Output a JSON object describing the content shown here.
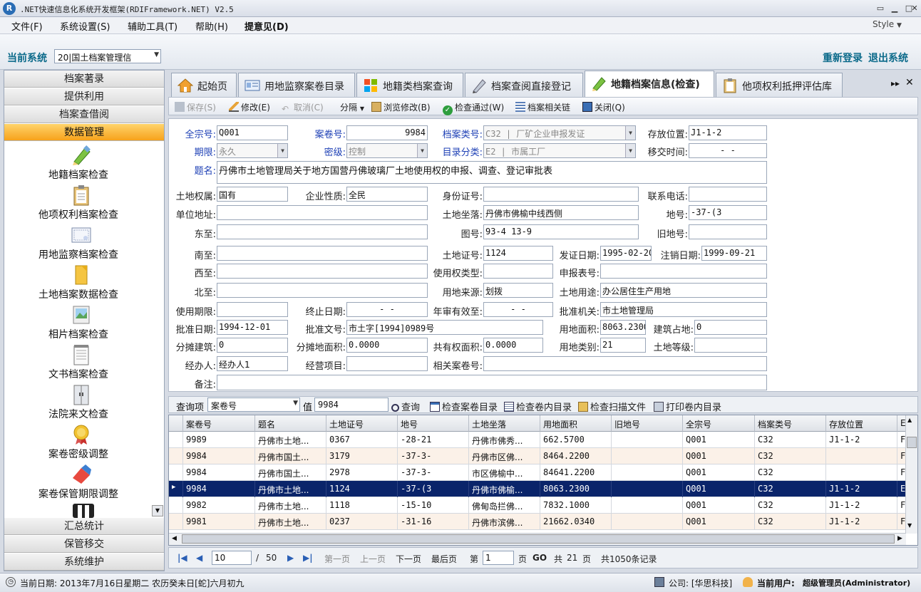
{
  "app": {
    "title": ".NET快速信息化系统开发框架(RDIFramework.NET) V2.5",
    "style_label": "Style"
  },
  "menu": [
    "文件(F)",
    "系统设置(S)",
    "辅助工具(T)",
    "帮助(H)",
    "提意见(D)"
  ],
  "sysbar": {
    "label": "当前系统",
    "system_value": "20|国土档案管理信",
    "relogin": "重新登录",
    "exit": "退出系统"
  },
  "sidebar": {
    "groups_top": [
      "档案著录",
      "提供利用",
      "档案查借阅",
      "数据管理"
    ],
    "items": [
      "地籍档案检查",
      "他项权利档案检查",
      "用地监察档案检查",
      "土地档案数据检查",
      "相片档案检查",
      "文书档案检查",
      "法院来文检查",
      "案卷密级调整",
      "案卷保管期限调整"
    ],
    "groups_bottom": [
      "汇总统计",
      "保管移交",
      "系统维护"
    ]
  },
  "tabs": [
    "起始页",
    "用地监察案卷目录",
    "地籍类档案查询",
    "档案查阅直接登记",
    "地籍档案信息(检查)",
    "他项权利抵押评估库"
  ],
  "toolbar": {
    "save": "保存(S)",
    "edit": "修改(E)",
    "cancel": "取消(C)",
    "split": "分隔",
    "browse_edit": "浏览修改(B)",
    "check_pass": "检查通过(W)",
    "related": "档案相关链",
    "close": "关闭(Q)"
  },
  "form": {
    "qzh_label": "全宗号:",
    "qzh": "Q001",
    "ajh_label": "案卷号:",
    "ajh": "9984",
    "dalb_label": "档案类号:",
    "dalb": "C32 | 厂矿企业申报发证",
    "cfwz_label": "存放位置:",
    "cfwz": "J1-1-2",
    "qx_label": "期限:",
    "qx": "永久",
    "mj_label": "密级:",
    "mj": "控制",
    "mlfl_label": "目录分类:",
    "mlfl": "E2 | 市属工厂",
    "yjsj_label": "移交时间:",
    "yjsj": "-  -",
    "tm_label": "题名:",
    "tm": "丹佛市土地管理局关于地方国营丹佛玻璃厂土地使用权的申报、调查、登记审批表",
    "tdqs_label": "土地权属:",
    "tdqs": "国有",
    "qyxz_label": "企业性质:",
    "qyxz": "全民",
    "sfzh_label": "身份证号:",
    "sfzh": "",
    "lxdh_label": "联系电话:",
    "lxdh": "",
    "dwdz_label": "单位地址:",
    "dwdz": "",
    "tdzl_label": "土地坐落:",
    "tdzl": "丹佛市佛榆中线西侧",
    "dh_label": "地号:",
    "dh": "-37-(3",
    "dz_label": "东至:",
    "dz": "",
    "th_label": "图号:",
    "th": "93-4 13-9",
    "jdh_label": "旧地号:",
    "jdh": "",
    "nz_label": "南至:",
    "nz": "",
    "tdzh_label": "土地证号:",
    "tdzh": "1124",
    "fzrq_label": "发证日期:",
    "fzrq": "1995-02-20",
    "zxrq_label": "注销日期:",
    "zxrq": "1999-09-21",
    "xz_label": "西至:",
    "xz": "",
    "syqlx_label": "使用权类型:",
    "syqlx": "",
    "sbbh_label": "申报表号:",
    "sbbh": "",
    "bz_label": "北至:",
    "bz": "",
    "ydly_label": "用地来源:",
    "ydly": "划拨",
    "tdyt_label": "土地用途:",
    "tdyt": "办公居住生产用地",
    "syqx_label": "使用期限:",
    "syqx": "",
    "zzrq_label": "终止日期:",
    "zzrq": "-  -",
    "nsyxz_label": "年审有效至:",
    "nsyxz": "-  -",
    "pzjg_label": "批准机关:",
    "pzjg": "市土地管理局",
    "pzrq_label": "批准日期:",
    "pzrq": "1994-12-01",
    "pzwh_label": "批准文号:",
    "pzwh": "市土字[1994]0989号",
    "ydmj_label": "用地面积:",
    "ydmj": "8063.2300",
    "jzzd_label": "建筑占地:",
    "jzzd": "0",
    "ftjz_label": "分摊建筑:",
    "ftjz": "0",
    "ftdmj_label": "分摊地面积:",
    "ftdmj": "0.0000",
    "gyqmj_label": "共有权面积:",
    "gyqmj": "0.0000",
    "ydlb_label": "用地类别:",
    "ydlb": "21",
    "tddj_label": "土地等级:",
    "tddj": "",
    "jbr_label": "经办人:",
    "jbr": "经办人1",
    "jyxm_label": "经营项目:",
    "jyxm": "",
    "xgajh_label": "相关案卷号:",
    "xgajh": "",
    "bz2_label": "备注:",
    "bz2": ""
  },
  "query": {
    "item_label": "查询项",
    "item_value": "案卷号",
    "value_label": "值",
    "value": "9984",
    "search": "查询",
    "check_vol": "检查案卷目录",
    "check_inner": "检查卷内目录",
    "check_scan": "检查扫描文件",
    "print_inner": "打印卷内目录"
  },
  "grid": {
    "columns": [
      "案卷号",
      "题名",
      "土地证号",
      "地号",
      "土地坐落",
      "用地面积",
      "旧地号",
      "全宗号",
      "档案类号",
      "存放位置",
      "E"
    ],
    "rows": [
      [
        "9989",
        "丹佛市土地...",
        "0367",
        "-28-21",
        "丹佛市佛秀...",
        "662.5700",
        "",
        "Q001",
        "C32",
        "J1-1-2",
        "F"
      ],
      [
        "9984",
        "丹佛市国土...",
        "3179",
        "-37-3-",
        "丹佛市区佛...",
        "8464.2200",
        "",
        "Q001",
        "C32",
        "",
        "F"
      ],
      [
        "9984",
        "丹佛市国土...",
        "2978",
        "-37-3-",
        "市区佛榆中...",
        "84641.2200",
        "",
        "Q001",
        "C32",
        "",
        "F"
      ],
      [
        "9984",
        "丹佛市土地...",
        "1124",
        "-37-(3",
        "丹佛市佛榆...",
        "8063.2300",
        "",
        "Q001",
        "C32",
        "J1-1-2",
        "E"
      ],
      [
        "9982",
        "丹佛市土地...",
        "1118",
        "-15-10",
        "佛甸岛拦佛...",
        "7832.1000",
        "",
        "Q001",
        "C32",
        "J1-1-2",
        "F"
      ],
      [
        "9981",
        "丹佛市土地...",
        "0237",
        "-31-16",
        "丹佛市滨佛...",
        "21662.0340",
        "",
        "Q001",
        "C32",
        "J1-1-2",
        "F"
      ]
    ]
  },
  "pager": {
    "page": "10",
    "sep": "/",
    "total_pages": "50",
    "first": "第一页",
    "prev": "上一页",
    "next": "下一页",
    "last": "最后页",
    "goto_prefix": "第",
    "goto_value": "1",
    "goto_suffix": "页",
    "go": "GO",
    "total_label": "共",
    "total_count": "21",
    "total_unit": "页",
    "records": "共1050条记录"
  },
  "status": {
    "date": "当前日期: 2013年7月16日星期二 农历癸未日[蛇]六月初九",
    "company": "公司: [华思科技]",
    "user_label": "当前用户:",
    "user": "超级管理员(Administrator)"
  }
}
